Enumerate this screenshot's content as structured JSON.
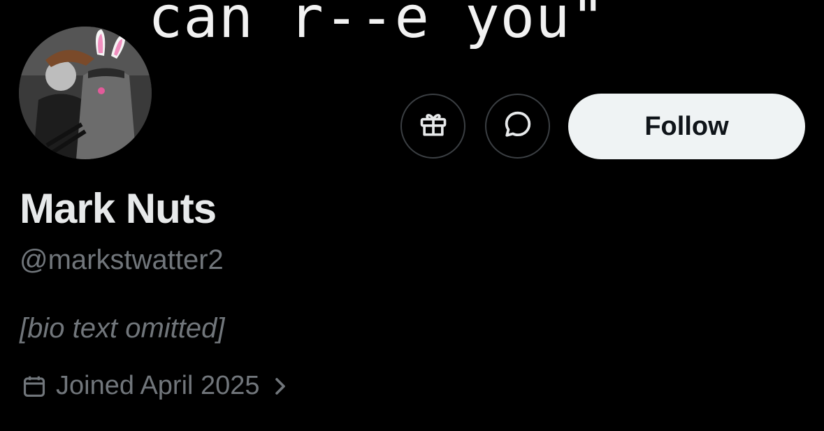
{
  "banner": {
    "text": "can r--e you\""
  },
  "actions": {
    "gift_icon": "gift-icon",
    "message_icon": "message-icon",
    "follow_label": "Follow"
  },
  "profile": {
    "display_name": "Mark Nuts",
    "handle": "@markstwatter2",
    "bio_placeholder": "[bio text omitted]",
    "joined": "Joined April 2025",
    "calendar_icon": "calendar-icon",
    "chevron_icon": "chevron-right-icon"
  },
  "colors": {
    "background": "#000000",
    "primary_text": "#e7e9ea",
    "secondary_text": "#71767b",
    "follow_bg": "#eff3f4",
    "button_border": "#3b3f43"
  }
}
